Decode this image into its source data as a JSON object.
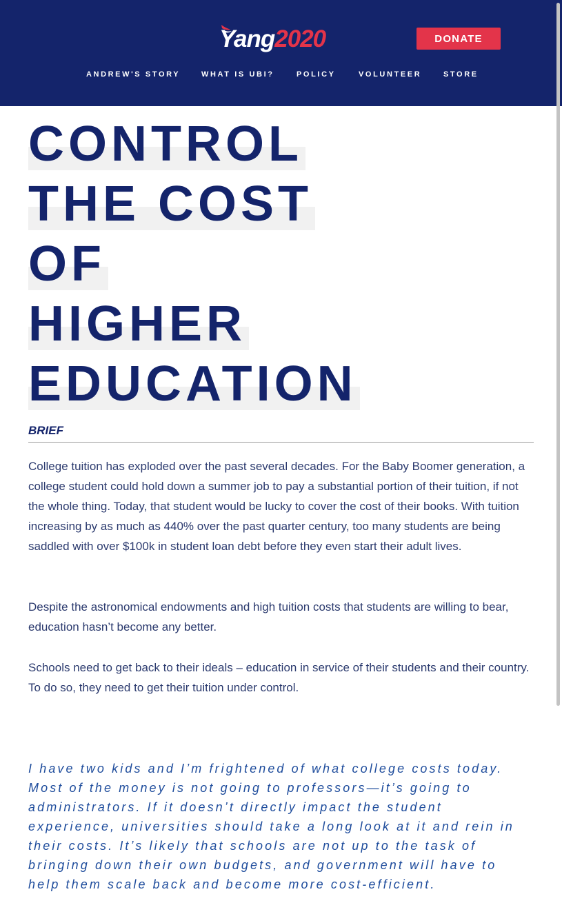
{
  "header": {
    "logo": {
      "name": "Yang",
      "year": "2020"
    },
    "donate_label": "DONATE",
    "nav": [
      {
        "label": "ANDREW'S STORY"
      },
      {
        "label": "WHAT IS UBI?"
      },
      {
        "label": "POLICY"
      },
      {
        "label": "VOLUNTEER"
      },
      {
        "label": "STORE"
      }
    ]
  },
  "page": {
    "title_lines": [
      "CONTROL",
      "THE COST",
      "OF",
      "HIGHER",
      "EDUCATION"
    ],
    "section_label": "BRIEF",
    "paragraphs": [
      "College tuition has exploded over the past several decades. For the Baby Boomer generation, a college student could hold down a summer job to pay a substantial portion of their tuition, if not the whole thing. Today, that student would be lucky to cover the cost of their books. With tuition increasing by as much as 440% over the past quarter century, too many students are being saddled with over $100k in student loan debt before they even start their adult lives.",
      "Despite the astronomical endowments and high tuition costs that students are willing to bear, education hasn’t become any better.",
      "Schools need to get back to their ideals – education in service of their students and their country. To do so, they need to get their tuition under control."
    ],
    "quote": "I have two kids and I’m frightened of what college costs today. Most of the money is not going to professors—it’s going to administrators. If it doesn’t directly impact the student experience, universities should take a long look at it and rein in their costs. It’s likely that schools are not up to the task of bringing down their own budgets, and government will have to help them scale back and become more cost-efficient."
  },
  "colors": {
    "navy": "#14246b",
    "red": "#e3344a",
    "quote_blue": "#1e4c9c"
  }
}
